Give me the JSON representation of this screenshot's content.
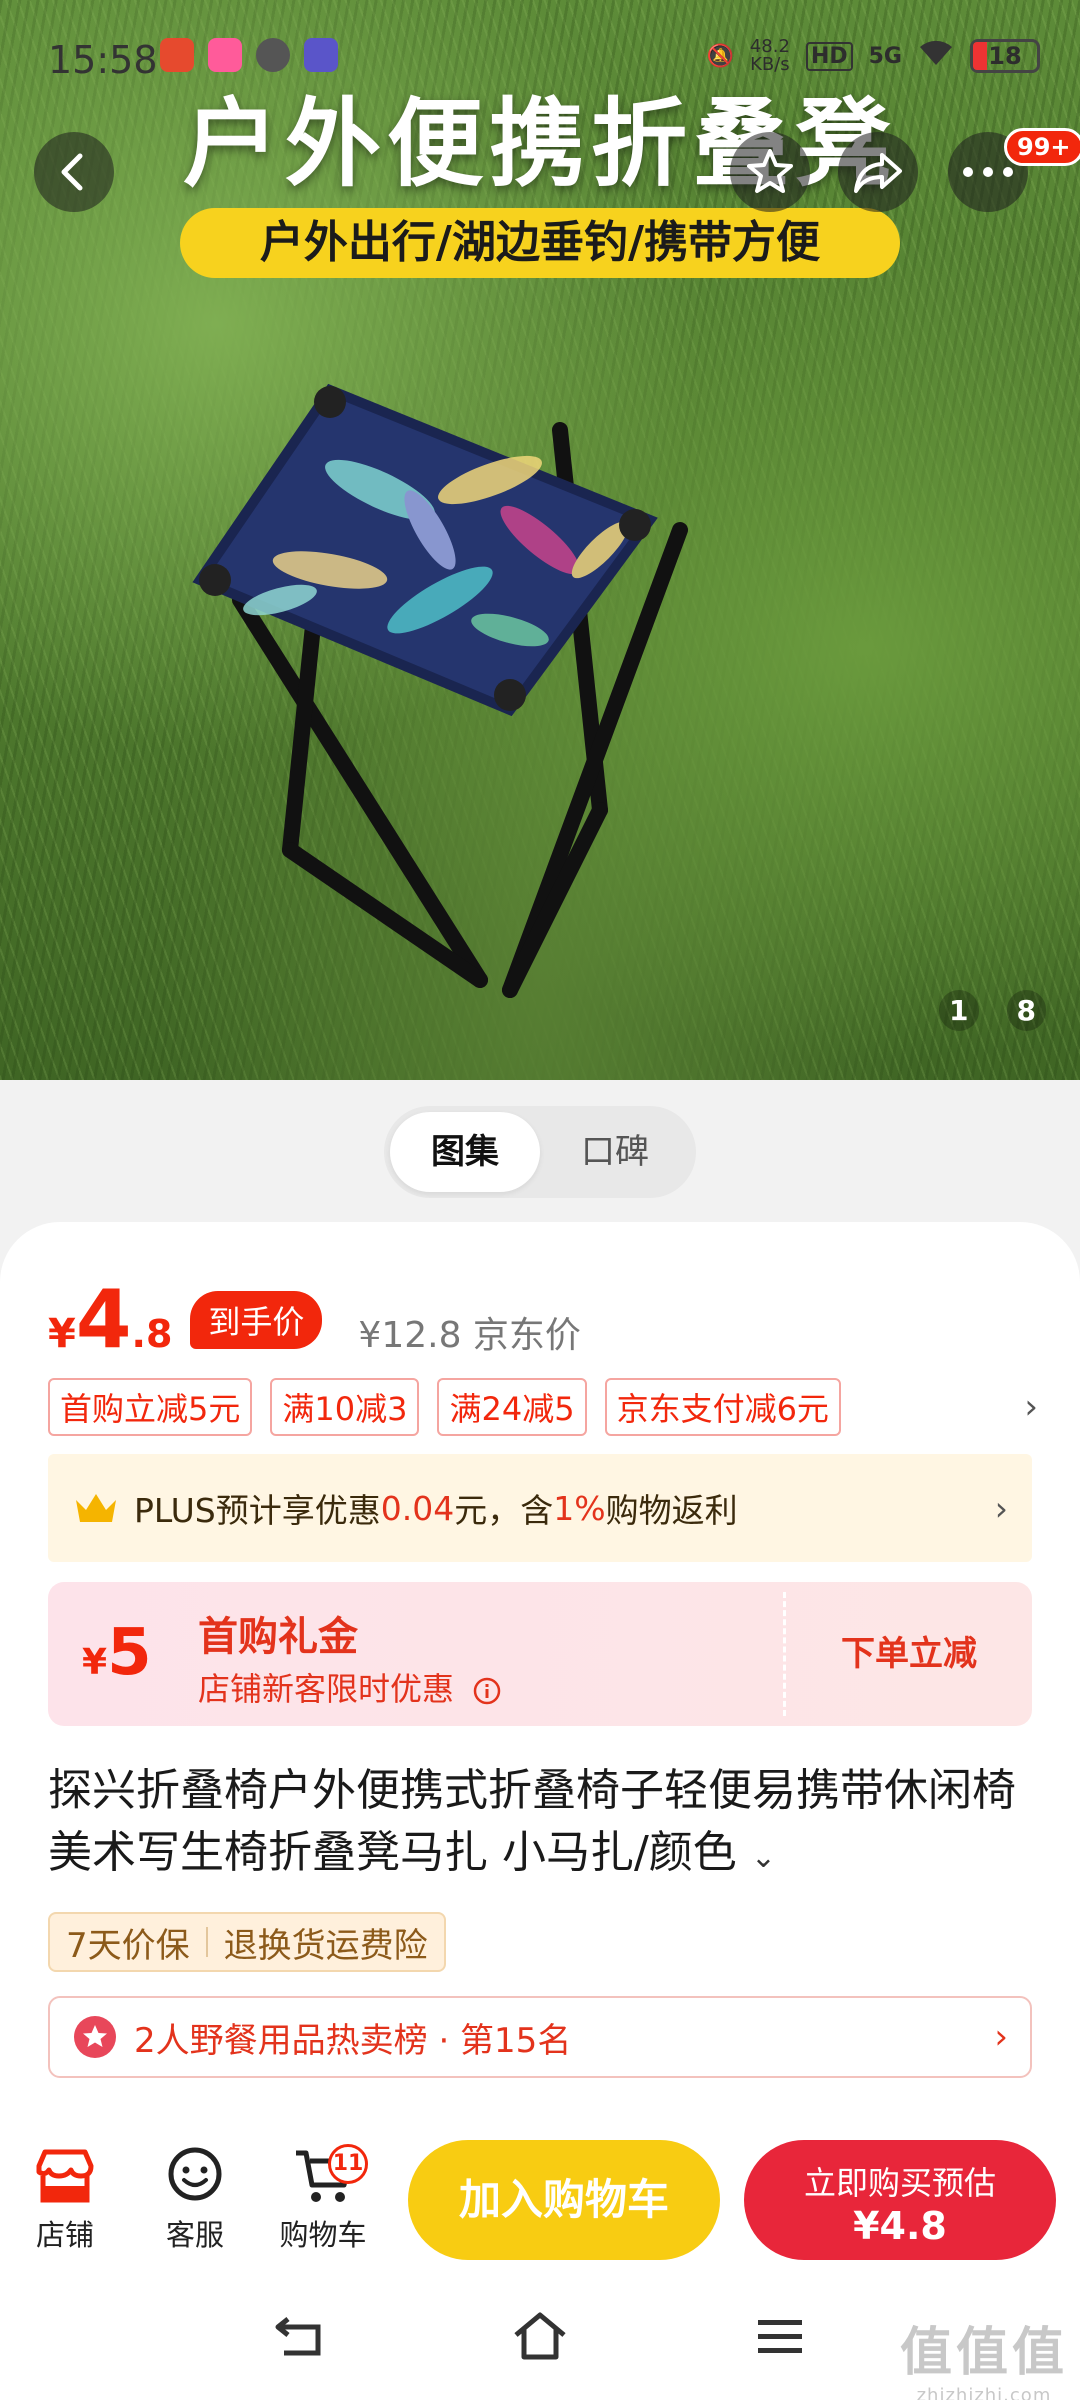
{
  "status_bar": {
    "time": "15:58",
    "net_speed": "48.2\nKB/s",
    "net_speed_value": "48.2",
    "net_speed_unit": "KB/s",
    "hd": "HD",
    "signal": "5G",
    "battery": "18"
  },
  "hero": {
    "title": "户外便携折叠凳",
    "subtitle": "户外出行/湖边垂钓/携带方便",
    "more_badge": "99+",
    "pager_current": "1",
    "pager_total": "8"
  },
  "toggle": {
    "gallery": "图集",
    "reviews": "口碑"
  },
  "price": {
    "currency": "¥",
    "integer": "4",
    "decimal": ".8",
    "tag": "到手价",
    "original": "¥12.8 京东价"
  },
  "coupons": [
    "首购立减5元",
    "满10减3",
    "满24减5",
    "京东支付减6元"
  ],
  "plus": {
    "prefix": "PLUS预计享优惠",
    "amount": "0.04",
    "mid": "元，含",
    "rate": "1%",
    "suffix": "购物返利"
  },
  "gift": {
    "currency": "¥",
    "amount": "5",
    "title": "首购礼金",
    "desc": "店铺新客限时优惠",
    "action": "下单立减"
  },
  "product_title": "探兴折叠椅户外便携式折叠椅子轻便易携带休闲椅美术写生椅折叠凳马扎 小马扎/颜色",
  "guarantee": [
    "7天价保",
    "退换货运费险"
  ],
  "rank": "2人野餐用品热卖榜 · 第15名",
  "actions": {
    "shop": "店铺",
    "service": "客服",
    "cart": "购物车",
    "cart_count": "11",
    "add_to_cart": "加入购物车",
    "buy_now": "立即购买预估",
    "buy_price": "¥4.8"
  },
  "watermark": {
    "text": "值值值",
    "url": "zhizhizhi.com"
  },
  "colors": {
    "accent": "#f2270c",
    "cart_button": "#f8cc12",
    "buy_button": "#e8263a"
  }
}
